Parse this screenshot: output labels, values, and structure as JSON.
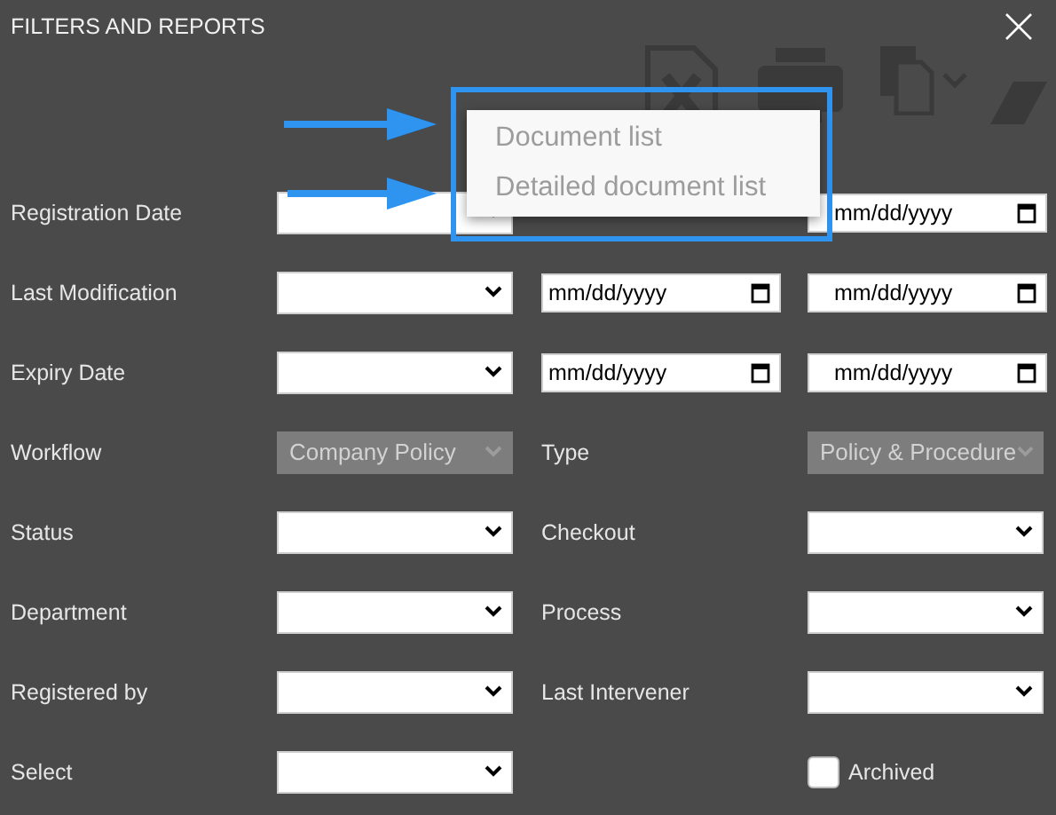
{
  "title": "FILTERS AND REPORTS",
  "popup": {
    "items": [
      "Document list",
      "Detailed document list"
    ]
  },
  "fields": [
    {
      "label": "Registration Date",
      "cells": [
        {
          "kind": "select",
          "disabled": false
        },
        {
          "kind": "covered"
        },
        {
          "kind": "date",
          "placeholder": "mm/dd/yyyy"
        }
      ]
    },
    {
      "label": "Last Modification",
      "cells": [
        {
          "kind": "select",
          "disabled": false
        },
        {
          "kind": "date",
          "placeholder": "mm/dd/yyyy"
        },
        {
          "kind": "date",
          "placeholder": "mm/dd/yyyy"
        }
      ]
    },
    {
      "label": "Expiry Date",
      "cells": [
        {
          "kind": "select",
          "disabled": false
        },
        {
          "kind": "date",
          "placeholder": "mm/dd/yyyy"
        },
        {
          "kind": "date",
          "placeholder": "mm/dd/yyyy"
        }
      ]
    },
    {
      "label": "Workflow",
      "cells": [
        {
          "kind": "select",
          "disabled": true,
          "value": "Company Policy"
        },
        {
          "kind": "label",
          "text": "Type"
        },
        {
          "kind": "select",
          "disabled": true,
          "value": "Policy & Procedure"
        }
      ]
    },
    {
      "label": "Status",
      "cells": [
        {
          "kind": "select",
          "disabled": false
        },
        {
          "kind": "label",
          "text": "Checkout"
        },
        {
          "kind": "select",
          "disabled": false
        }
      ]
    },
    {
      "label": "Department",
      "cells": [
        {
          "kind": "select",
          "disabled": false
        },
        {
          "kind": "label",
          "text": "Process"
        },
        {
          "kind": "select",
          "disabled": false
        }
      ]
    },
    {
      "label": "Registered by",
      "cells": [
        {
          "kind": "select",
          "disabled": false
        },
        {
          "kind": "label",
          "text": "Last Intervener"
        },
        {
          "kind": "select",
          "disabled": false
        }
      ]
    },
    {
      "label": "Select",
      "cells": [
        {
          "kind": "select",
          "disabled": false
        },
        {
          "kind": "empty"
        },
        {
          "kind": "checkbox",
          "text": "Archived",
          "checked": false
        }
      ]
    }
  ]
}
